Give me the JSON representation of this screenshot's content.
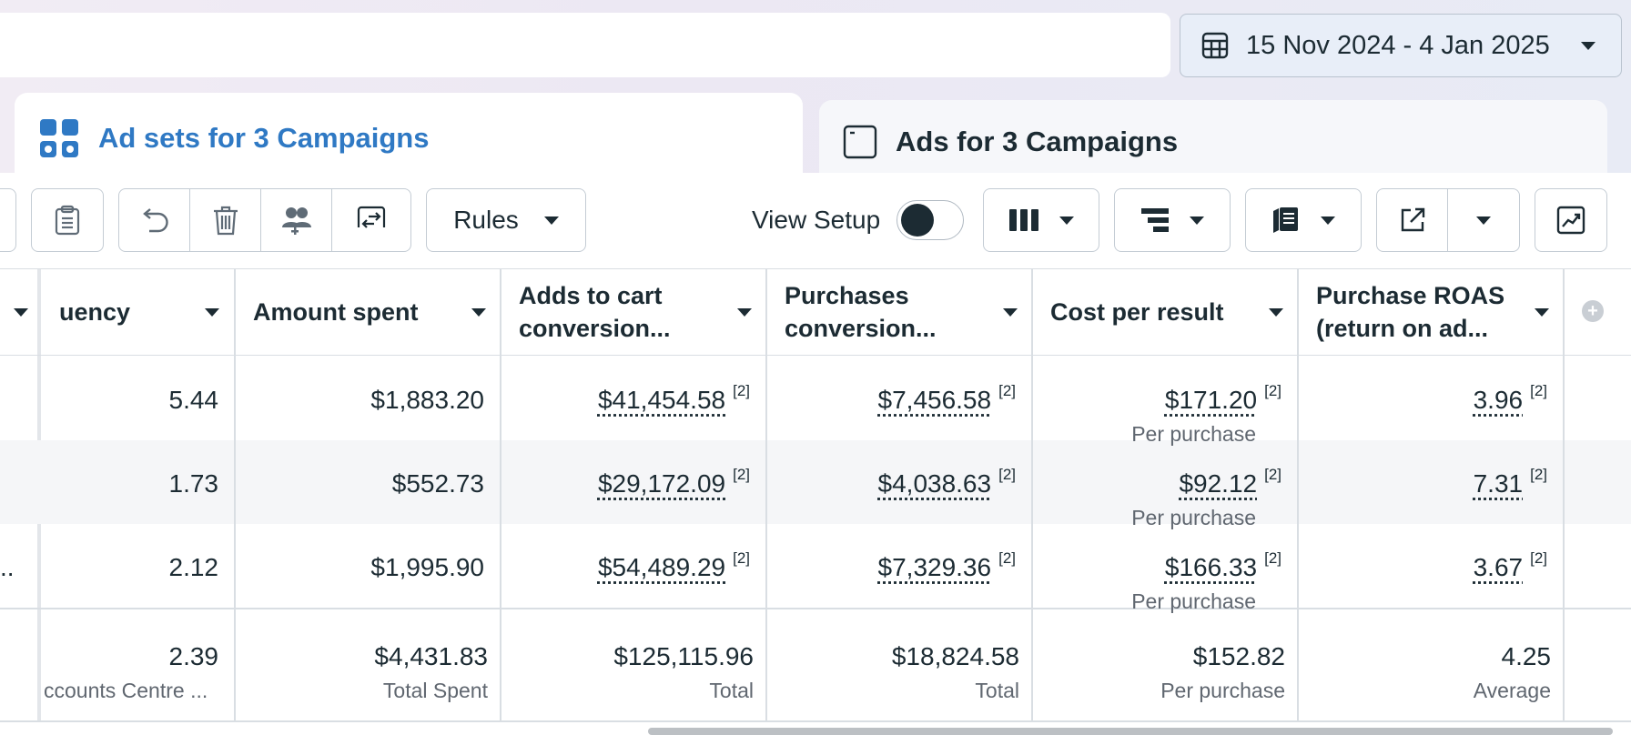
{
  "date_range": {
    "label": "15 Nov 2024 - 4 Jan 2025"
  },
  "tabs": [
    {
      "label": "Ad sets for 3 Campaigns",
      "active": true
    },
    {
      "label": "Ads for 3 Campaigns",
      "active": false
    }
  ],
  "toolbar": {
    "rules_label": "Rules",
    "view_setup_label": "View Setup"
  },
  "columns": [
    {
      "label": "uency"
    },
    {
      "label": "Amount spent"
    },
    {
      "label": "Adds to cart conversion..."
    },
    {
      "label": "Purchases conversion..."
    },
    {
      "label": "Cost per result"
    },
    {
      "label": "Purchase ROAS (return on ad..."
    }
  ],
  "rows": [
    {
      "left": "",
      "frequency": "5.44",
      "amount_spent": "$1,883.20",
      "adds_to_cart": "$41,454.58",
      "purchases": "$7,456.58",
      "cost_per_result": "$171.20",
      "cost_sub": "Per purchase",
      "roas": "3.96",
      "sup": "[2]"
    },
    {
      "left": "",
      "frequency": "1.73",
      "amount_spent": "$552.73",
      "adds_to_cart": "$29,172.09",
      "purchases": "$4,038.63",
      "cost_per_result": "$92.12",
      "cost_sub": "Per purchase",
      "roas": "7.31",
      "sup": "[2]"
    },
    {
      "left": "..",
      "frequency": "2.12",
      "amount_spent": "$1,995.90",
      "adds_to_cart": "$54,489.29",
      "purchases": "$7,329.36",
      "cost_per_result": "$166.33",
      "cost_sub": "Per purchase",
      "roas": "3.67",
      "sup": "[2]"
    }
  ],
  "totals": {
    "frequency": "2.39",
    "frequency_sub": "ccounts Centre ...",
    "amount_spent": "$4,431.83",
    "amount_spent_sub": "Total Spent",
    "adds_to_cart": "$125,115.96",
    "adds_to_cart_sub": "Total",
    "purchases": "$18,824.58",
    "purchases_sub": "Total",
    "cost_per_result": "$152.82",
    "cost_per_result_sub": "Per purchase",
    "roas": "4.25",
    "roas_sub": "Average"
  },
  "colors": {
    "accent": "#2f79c4",
    "text": "#1c2b33",
    "muted": "#606770"
  }
}
